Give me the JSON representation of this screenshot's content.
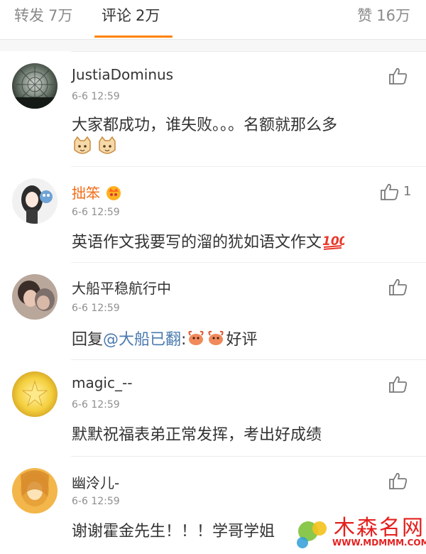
{
  "tabs": {
    "repost": {
      "label": "转发",
      "count": "7万"
    },
    "comments": {
      "label": "评论",
      "count": "2万"
    },
    "likes": {
      "label": "赞",
      "count": "16万"
    }
  },
  "colors": {
    "accent": "#ff8200",
    "vip_name": "#f26c16",
    "mention": "#4a7aaf",
    "watermark": "#e4201e"
  },
  "comments": [
    {
      "username": "JustiaDominus",
      "time": "6-6 12:59",
      "text": "大家都成功，谁失败。。。名额就那么多",
      "emoji": [
        "cat-face-emoji",
        "cat-face-emoji"
      ],
      "likes": ""
    },
    {
      "username": "拙笨",
      "time": "6-6 12:59",
      "text": "英语作文我要写的溜的犹如语文作文",
      "emoji_inline": "100-emoji",
      "badge": "vip-crown-badge",
      "likes": "1"
    },
    {
      "username": "大船平稳航行中",
      "time": "6-6 12:59",
      "reply_prefix": "回复",
      "mention": "@大船已翻",
      "colon": ":",
      "emoji": [
        "lobster-emoji",
        "lobster-emoji"
      ],
      "suffix": "好评",
      "likes": ""
    },
    {
      "username": "magic_--",
      "time": "6-6 12:59",
      "text": "默默祝福表弟正常发挥，考出好成绩",
      "likes": ""
    },
    {
      "username": "幽泠儿-",
      "time": "6-6 12:59",
      "text": "谢谢霍金先生！！！学哥学姐",
      "likes": ""
    }
  ],
  "watermark": {
    "title": "木森名网",
    "url": "WWW.MDMMM.COM"
  }
}
